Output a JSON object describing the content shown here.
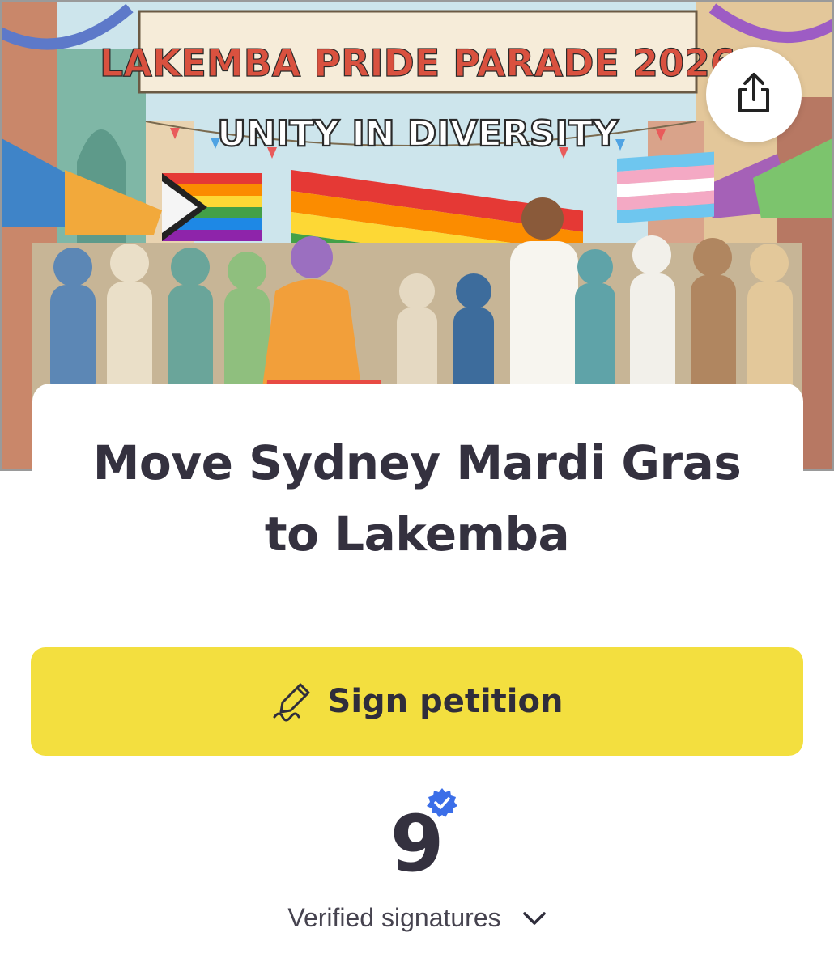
{
  "hero": {
    "banner_title": "LAKEMBA PRIDE PARADE 2026",
    "banner_subtitle": "UNITY IN DIVERSITY"
  },
  "share": {
    "icon": "share-icon"
  },
  "petition": {
    "title_line1": "Move Sydney Mardi Gras",
    "title_line2": "to Lakemba"
  },
  "sign_button": {
    "label": "Sign petition",
    "icon": "pen-signature-icon",
    "color": "#f3df3f"
  },
  "signatures": {
    "count": "9",
    "label": "Verified signatures",
    "badge_icon": "verified-check-icon",
    "badge_color": "#3b6ee8"
  }
}
